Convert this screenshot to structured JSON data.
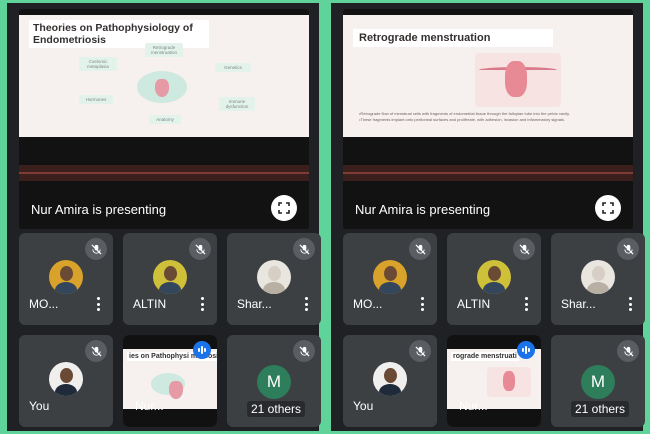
{
  "left": {
    "slide": {
      "title": "Theories on Pathophysiology of Endometriosis",
      "nodes": [
        "Retrograde menstruation",
        "Coelomic metaplasia",
        "Genetics",
        "Hormones",
        "Immune dysfunction",
        "Anatomy"
      ]
    },
    "presenting": "Nur Amira is presenting",
    "tiles": [
      {
        "name": "MO..."
      },
      {
        "name": "ALTIN"
      },
      {
        "name": "Shar..."
      },
      {
        "name": "You"
      },
      {
        "name": "Nur..."
      },
      {
        "name": "21 others",
        "initial": "M"
      }
    ],
    "mini_title": "ies on Pathophysi metriosis"
  },
  "right": {
    "slide": {
      "title": "Retrograde menstruation",
      "bullets": [
        "Retrograde flow of menstrual cells with fragments of endometrial tissue through the fallopian tube into the pelvic cavity.",
        "These fragments implant onto peritoneal surfaces and proliferate, with adhesion, invasion and inflammatory signals."
      ]
    },
    "presenting": "Nur Amira is presenting",
    "tiles": [
      {
        "name": "MO..."
      },
      {
        "name": "ALTIN"
      },
      {
        "name": "Shar..."
      },
      {
        "name": "You"
      },
      {
        "name": "Nur..."
      },
      {
        "name": "21 others",
        "initial": "M"
      }
    ],
    "mini_title": "rograde menstruati"
  },
  "colors": {
    "background": "#5fd39a",
    "panel": "#202124",
    "tile": "#3c4043",
    "accent": "#1a73e8"
  }
}
